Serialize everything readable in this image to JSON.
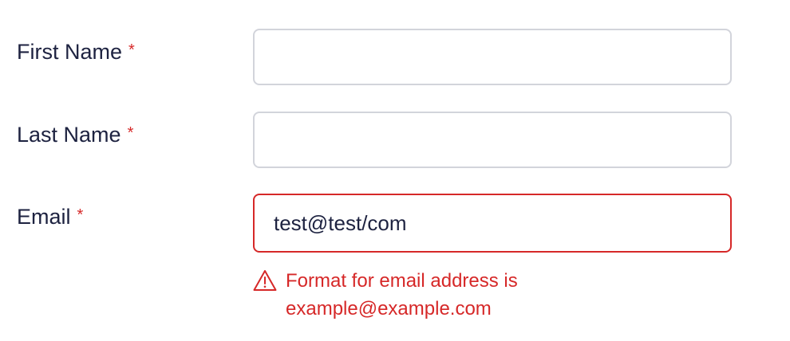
{
  "form": {
    "first_name": {
      "label": "First Name",
      "required_marker": "*",
      "value": "",
      "placeholder": ""
    },
    "last_name": {
      "label": "Last Name",
      "required_marker": "*",
      "value": "",
      "placeholder": ""
    },
    "email": {
      "label": "Email",
      "required_marker": "*",
      "value": "test@test/com",
      "placeholder": "",
      "error_icon": "warning-triangle-icon",
      "error_message": "Format for email address is example@example.com"
    }
  },
  "colors": {
    "text": "#1d2240",
    "error": "#d62828",
    "input_border": "#d2d4db"
  }
}
